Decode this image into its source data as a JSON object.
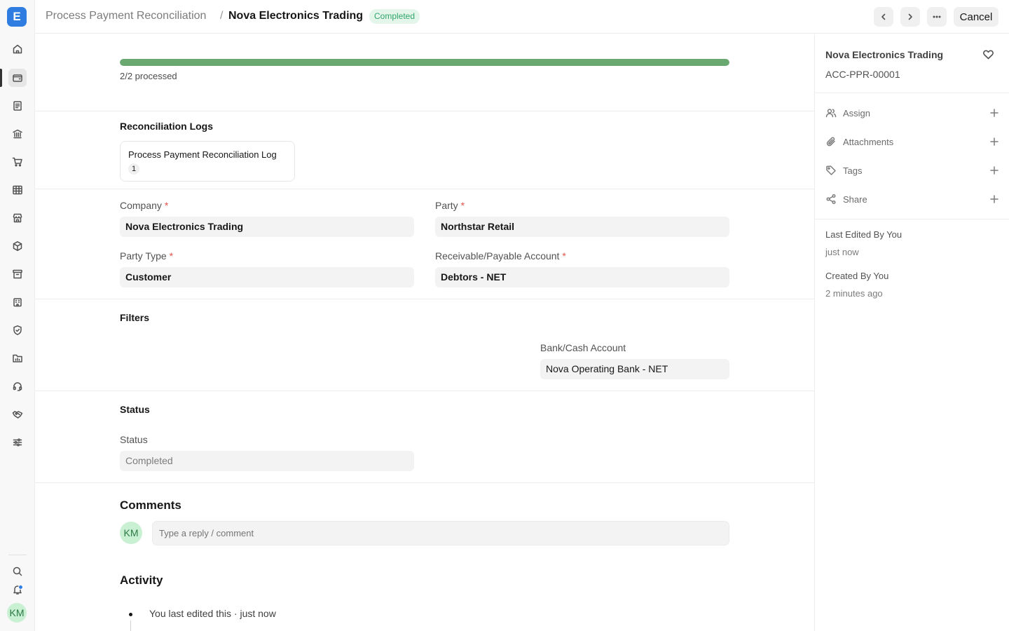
{
  "app": {
    "logo_letter": "E"
  },
  "header": {
    "breadcrumb_parent": "Process Payment Reconciliation",
    "breadcrumb_sep": "/",
    "title": "Nova Electronics Trading",
    "status": "Completed",
    "cancel_label": "Cancel"
  },
  "progress": {
    "fraction": 1.0,
    "label": "2/2 processed",
    "color": "#69a96f"
  },
  "logs": {
    "title": "Reconciliation Logs",
    "card_label": "Process Payment Reconciliation Log",
    "card_count": "1"
  },
  "fields": {
    "company_label": "Company",
    "company_value": "Nova Electronics Trading",
    "party_label": "Party",
    "party_value": "Northstar Retail",
    "party_type_label": "Party Type",
    "party_type_value": "Customer",
    "account_label": "Receivable/Payable Account",
    "account_value": "Debtors - NET",
    "required_mark": "*"
  },
  "filters": {
    "title": "Filters",
    "bank_label": "Bank/Cash Account",
    "bank_value": "Nova Operating Bank - NET"
  },
  "status_section": {
    "title": "Status",
    "label": "Status",
    "value": "Completed"
  },
  "comments": {
    "title": "Comments",
    "avatar_initials": "KM",
    "placeholder": "Type a reply / comment"
  },
  "activity": {
    "title": "Activity",
    "items": [
      "You last edited this · just now"
    ]
  },
  "sidebar": {
    "title": "Nova Electronics Trading",
    "doc_id": "ACC-PPR-00001",
    "rows": [
      {
        "label": "Assign",
        "icon": "users-icon"
      },
      {
        "label": "Attachments",
        "icon": "paperclip-icon"
      },
      {
        "label": "Tags",
        "icon": "tag-icon"
      },
      {
        "label": "Share",
        "icon": "share-icon"
      }
    ],
    "last_edited_label": "Last Edited By You",
    "last_edited_time": "just now",
    "created_label": "Created By You",
    "created_time": "2 minutes ago"
  },
  "rail": {
    "avatar_initials": "KM",
    "icons": [
      "home-icon",
      "wallet-icon",
      "file-text-icon",
      "bank-icon",
      "cart-icon",
      "table-icon",
      "store-icon",
      "package-icon",
      "archive-icon",
      "building-icon",
      "shield-icon",
      "folder-chart-icon",
      "headset-icon",
      "handshake-icon",
      "sliders-icon"
    ],
    "active_index": 1,
    "brand_color": "#2f7de1"
  }
}
